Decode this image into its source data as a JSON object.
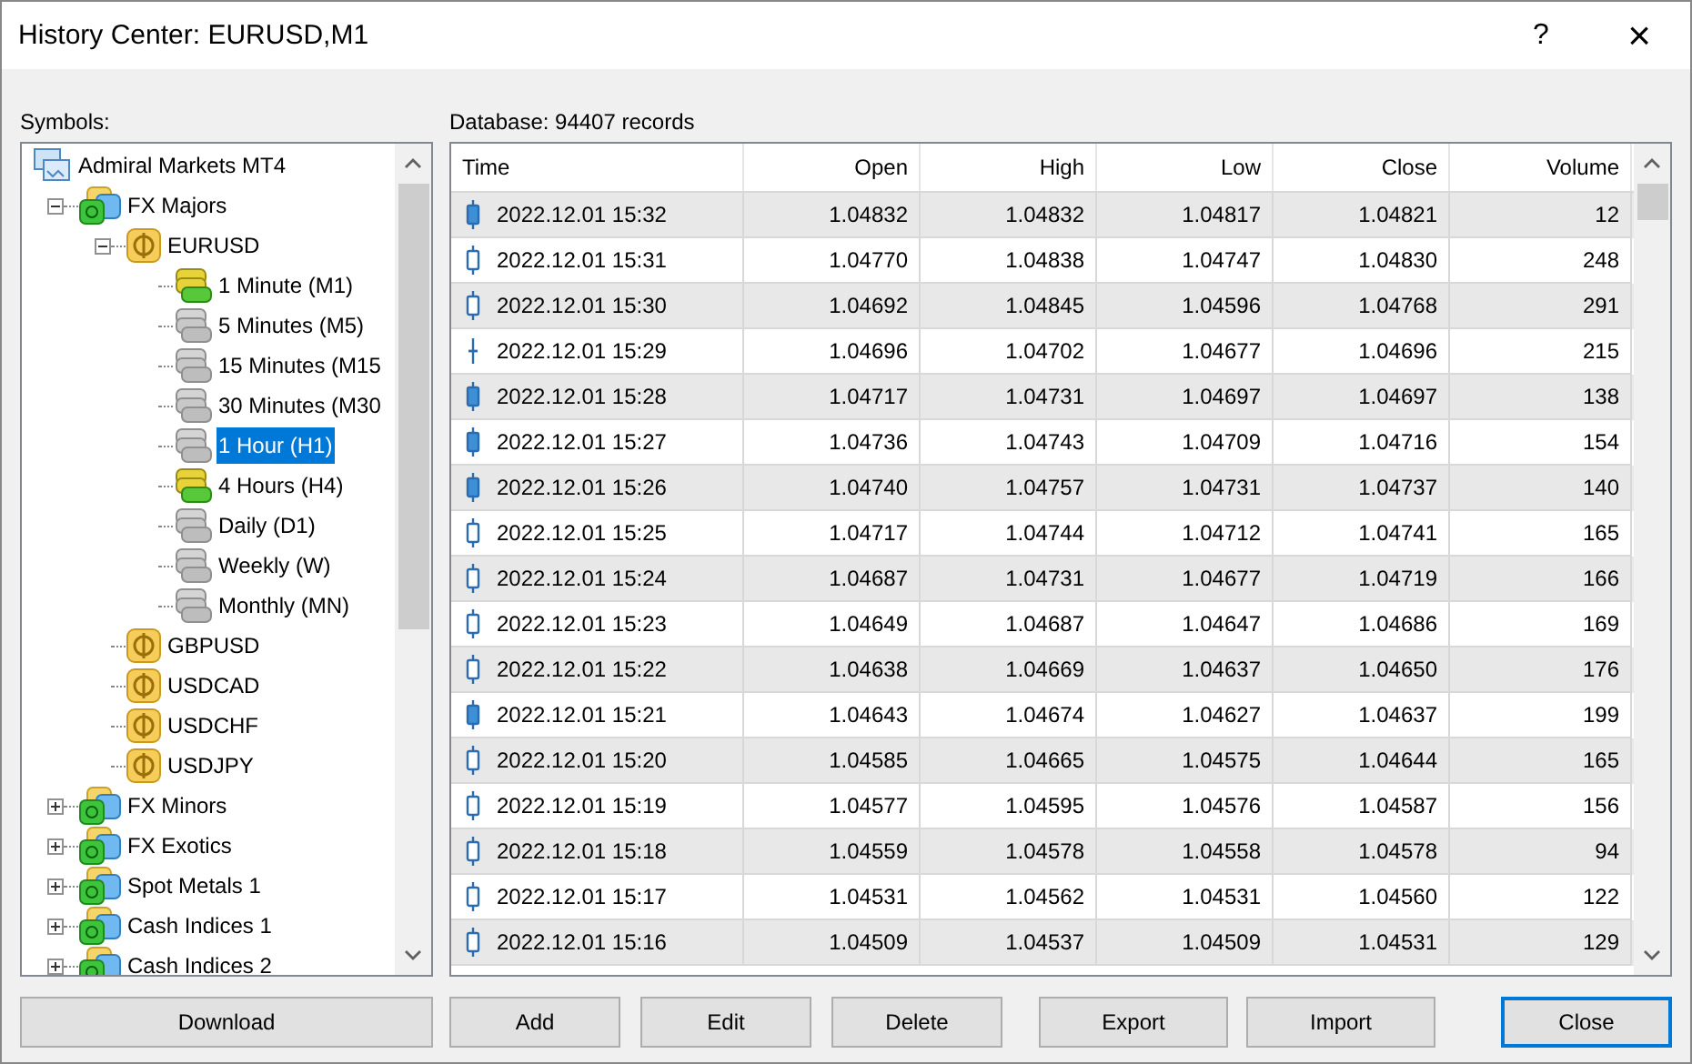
{
  "window": {
    "title": "History Center: EURUSD,M1",
    "help": "?",
    "close": "×"
  },
  "symbols_label": "Symbols:",
  "tree": [
    {
      "kind": "broker",
      "label": "Admiral Markets MT4",
      "children": [
        {
          "kind": "group",
          "label": "FX Majors",
          "expanded": true,
          "children": [
            {
              "kind": "symbol",
              "label": "EURUSD",
              "expanded": true,
              "children": [
                {
                  "kind": "period",
                  "label": "1 Minute (M1)",
                  "has_data": true,
                  "selected": false
                },
                {
                  "kind": "period",
                  "label": "5 Minutes (M5)",
                  "has_data": false,
                  "selected": false
                },
                {
                  "kind": "period",
                  "label": "15 Minutes (M15",
                  "has_data": false,
                  "selected": false
                },
                {
                  "kind": "period",
                  "label": "30 Minutes (M30",
                  "has_data": false,
                  "selected": false
                },
                {
                  "kind": "period",
                  "label": "1 Hour (H1)",
                  "has_data": false,
                  "selected": true
                },
                {
                  "kind": "period",
                  "label": "4 Hours (H4)",
                  "has_data": true,
                  "selected": false
                },
                {
                  "kind": "period",
                  "label": "Daily (D1)",
                  "has_data": false,
                  "selected": false
                },
                {
                  "kind": "period",
                  "label": "Weekly (W)",
                  "has_data": false,
                  "selected": false
                },
                {
                  "kind": "period",
                  "label": "Monthly (MN)",
                  "has_data": false,
                  "selected": false
                }
              ]
            },
            {
              "kind": "symbol",
              "label": "GBPUSD"
            },
            {
              "kind": "symbol",
              "label": "USDCAD"
            },
            {
              "kind": "symbol",
              "label": "USDCHF"
            },
            {
              "kind": "symbol",
              "label": "USDJPY"
            }
          ]
        },
        {
          "kind": "group",
          "label": "FX Minors",
          "expanded": false
        },
        {
          "kind": "group",
          "label": "FX Exotics",
          "expanded": false
        },
        {
          "kind": "group",
          "label": "Spot Metals 1",
          "expanded": false
        },
        {
          "kind": "group",
          "label": "Cash Indices 1",
          "expanded": false
        },
        {
          "kind": "group",
          "label": "Cash Indices 2",
          "expanded": false
        }
      ]
    }
  ],
  "database_label": "Database: 94407 records",
  "table": {
    "columns": [
      "Time",
      "Open",
      "High",
      "Low",
      "Close",
      "Volume"
    ],
    "rows": [
      {
        "kind": "bear",
        "cells": [
          "2022.12.01 15:32",
          "1.04832",
          "1.04832",
          "1.04817",
          "1.04821",
          "12"
        ]
      },
      {
        "kind": "bull",
        "cells": [
          "2022.12.01 15:31",
          "1.04770",
          "1.04838",
          "1.04747",
          "1.04830",
          "248"
        ]
      },
      {
        "kind": "bull",
        "cells": [
          "2022.12.01 15:30",
          "1.04692",
          "1.04845",
          "1.04596",
          "1.04768",
          "291"
        ]
      },
      {
        "kind": "doji",
        "cells": [
          "2022.12.01 15:29",
          "1.04696",
          "1.04702",
          "1.04677",
          "1.04696",
          "215"
        ]
      },
      {
        "kind": "bear",
        "cells": [
          "2022.12.01 15:28",
          "1.04717",
          "1.04731",
          "1.04697",
          "1.04697",
          "138"
        ]
      },
      {
        "kind": "bear",
        "cells": [
          "2022.12.01 15:27",
          "1.04736",
          "1.04743",
          "1.04709",
          "1.04716",
          "154"
        ]
      },
      {
        "kind": "bear",
        "cells": [
          "2022.12.01 15:26",
          "1.04740",
          "1.04757",
          "1.04731",
          "1.04737",
          "140"
        ]
      },
      {
        "kind": "bull",
        "cells": [
          "2022.12.01 15:25",
          "1.04717",
          "1.04744",
          "1.04712",
          "1.04741",
          "165"
        ]
      },
      {
        "kind": "bull",
        "cells": [
          "2022.12.01 15:24",
          "1.04687",
          "1.04731",
          "1.04677",
          "1.04719",
          "166"
        ]
      },
      {
        "kind": "bull",
        "cells": [
          "2022.12.01 15:23",
          "1.04649",
          "1.04687",
          "1.04647",
          "1.04686",
          "169"
        ]
      },
      {
        "kind": "bull",
        "cells": [
          "2022.12.01 15:22",
          "1.04638",
          "1.04669",
          "1.04637",
          "1.04650",
          "176"
        ]
      },
      {
        "kind": "bear",
        "cells": [
          "2022.12.01 15:21",
          "1.04643",
          "1.04674",
          "1.04627",
          "1.04637",
          "199"
        ]
      },
      {
        "kind": "bull",
        "cells": [
          "2022.12.01 15:20",
          "1.04585",
          "1.04665",
          "1.04575",
          "1.04644",
          "165"
        ]
      },
      {
        "kind": "bull",
        "cells": [
          "2022.12.01 15:19",
          "1.04577",
          "1.04595",
          "1.04576",
          "1.04587",
          "156"
        ]
      },
      {
        "kind": "bull",
        "cells": [
          "2022.12.01 15:18",
          "1.04559",
          "1.04578",
          "1.04558",
          "1.04578",
          "94"
        ]
      },
      {
        "kind": "bull",
        "cells": [
          "2022.12.01 15:17",
          "1.04531",
          "1.04562",
          "1.04531",
          "1.04560",
          "122"
        ]
      },
      {
        "kind": "bull",
        "cells": [
          "2022.12.01 15:16",
          "1.04509",
          "1.04537",
          "1.04509",
          "1.04531",
          "129"
        ]
      }
    ]
  },
  "left_button": "Download",
  "buttons": [
    {
      "label": "Add",
      "kind": "normal"
    },
    {
      "label": "Edit",
      "kind": "normal"
    },
    {
      "label": "Delete",
      "kind": "normal"
    },
    {
      "label": "Export",
      "kind": "normal"
    },
    {
      "label": "Import",
      "kind": "normal"
    },
    {
      "label": "Close",
      "kind": "default"
    }
  ]
}
